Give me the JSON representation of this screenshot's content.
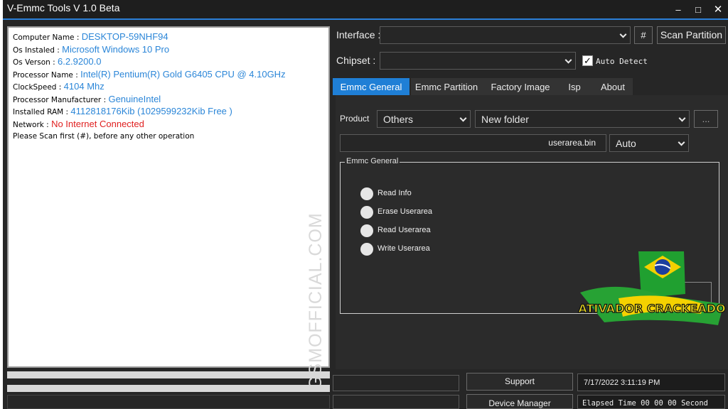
{
  "window": {
    "title": "V-Emmc Tools V 1.0 Beta"
  },
  "info": {
    "rows": [
      {
        "key": "Computer Name : ",
        "value": "DESKTOP-59NHF94"
      },
      {
        "key": "Os Instaled : ",
        "value": "Microsoft Windows 10 Pro"
      },
      {
        "key": "Os Verson : ",
        "value": "6.2.9200.0"
      },
      {
        "key": "Processor Name : ",
        "value": "Intel(R) Pentium(R) Gold G6405 CPU @ 4.10GHz"
      },
      {
        "key": "ClockSpeed : ",
        "value": "4104 Mhz"
      },
      {
        "key": "Processor Manufacturer : ",
        "value": "GenuineIntel"
      },
      {
        "key": "Installed RAM : ",
        "value": "4112818176Kib (1029599232Kib Free )"
      },
      {
        "key": "Network : ",
        "value": "No Internet Connected"
      },
      {
        "key": "Please Scan first (#), before any other operation",
        "value": ""
      }
    ],
    "watermark": "GSMOFFICIAL.COM"
  },
  "top": {
    "interface_label": "Interface :",
    "interface_value": "",
    "hash_label": "#",
    "scan_label": "Scan Partition",
    "chipset_label": "Chipset :",
    "chipset_value": "",
    "auto_detect_label": "Auto Detect",
    "auto_detect_checked": true
  },
  "tabs": [
    "Emmc General",
    "Emmc Partition",
    "Factory Image",
    "Isp",
    "About"
  ],
  "general": {
    "product_label": "Product",
    "product_value": "Others",
    "folder_value": "New folder",
    "browse_label": "...",
    "file_value": "userarea.bin",
    "mode_value": "Auto",
    "group_label": "Emmc General",
    "options": [
      "Read Info",
      "Erase Userarea",
      "Read Userarea",
      "Write Userarea"
    ]
  },
  "overlay_logo_text": "ATIVADOR CRACKEADO",
  "bottom": {
    "support_label": "Support",
    "device_manager_label": "Device Manager",
    "datetime": "7/17/2022 3:11:19 PM",
    "elapsed": "Elapsed Time 00 00 00 Second"
  },
  "colors": {
    "accent": "#1f7fd6",
    "value_text": "#2b86d8",
    "error_text": "#e01f1f",
    "background": "#262626"
  }
}
